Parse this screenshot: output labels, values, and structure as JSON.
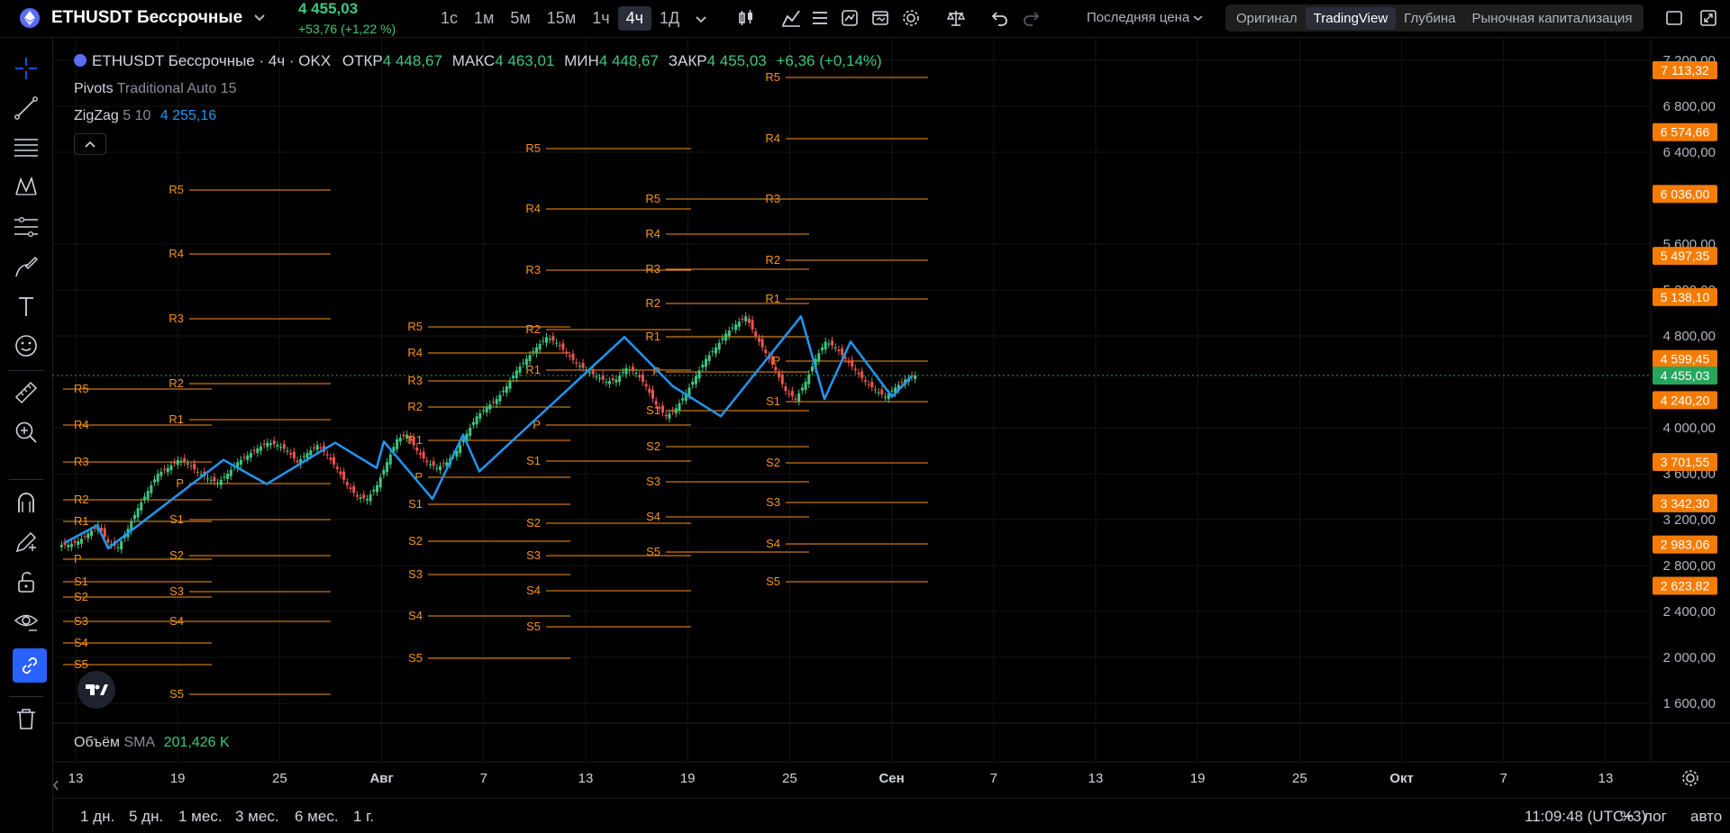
{
  "topbar": {
    "symbol": "ETHUSDT Бессрочные",
    "last_price": "4 455,03",
    "change": "+53,76 (+1,22 %)",
    "intervals": [
      "1с",
      "1м",
      "5м",
      "15м",
      "1ч",
      "4ч",
      "1Д"
    ],
    "active_interval": "4ч",
    "price_type": "Последняя цена",
    "view_tabs": [
      "Оригинал",
      "TradingView",
      "Глубина",
      "Рыночная капитализация"
    ],
    "active_view": "TradingView"
  },
  "legend": {
    "title": "ETHUSDT Бессрочные · 4ч · OKX",
    "open_label": "ОТКР",
    "open": "4 448,67",
    "high_label": "МАКС",
    "high": "4 463,01",
    "low_label": "МИН",
    "low": "4 448,67",
    "close_label": "ЗАКР",
    "close": "4 455,03",
    "change": "+6,36 (+0,14%)"
  },
  "indicators": {
    "pivots_name": "Pivots",
    "pivots_params": "Traditional Auto 15",
    "zigzag_name": "ZigZag",
    "zigzag_params": "5 10",
    "zigzag_value": "4 255,16"
  },
  "volume": {
    "label": "Объём",
    "sma": "SMA",
    "value": "201,426 K"
  },
  "bottom": {
    "ranges": [
      "1 дн.",
      "5 дн.",
      "1 мес.",
      "3 мес.",
      "6 мес.",
      "1 г."
    ],
    "clock": "11:09:48 (UTC+3)",
    "percent": "%",
    "log": "лог",
    "auto": "авто"
  },
  "colors": {
    "up": "#3dc77f",
    "down": "#ef5350",
    "pivot": "#f7931a",
    "zigzag": "#2196f3",
    "badge": "#f57c00",
    "last_badge": "#26a65b"
  },
  "chart_data": {
    "type": "candlestick",
    "price_axis": [
      "7 200,00",
      "6 800,00",
      "6 400,00",
      "5 600,00",
      "5 200,00",
      "4 800,00",
      "4 000,00",
      "3 600,00",
      "3 200,00",
      "2 800,00",
      "2 400,00",
      "2 000,00",
      "1 600,00"
    ],
    "price_badges": [
      "7 113,32",
      "6 574,66",
      "6 036,00",
      "5 497,35",
      "5 138,10",
      "4 599,45",
      "4 240,20",
      "3 701,55",
      "3 342,30",
      "2 983,06",
      "2 623,82"
    ],
    "last_price_badge": "4 455,03",
    "time_axis": [
      "13",
      "19",
      "25",
      "Авг",
      "7",
      "13",
      "19",
      "25",
      "Сен",
      "7",
      "13",
      "19",
      "25",
      "Окт",
      "7",
      "13"
    ],
    "pivot_labels": [
      "R5",
      "R4",
      "R3",
      "R2",
      "R1",
      "P",
      "S1",
      "S2",
      "S3",
      "S4",
      "S5"
    ],
    "zigzag": [
      3000,
      3150,
      2950,
      3720,
      3510,
      3870,
      3650,
      3880,
      3380,
      3940,
      3620,
      4790,
      4360,
      4100,
      4970,
      4250,
      4750,
      4270,
      4450
    ],
    "ohlc_close_series": [
      2980,
      3010,
      3080,
      3150,
      3000,
      2960,
      3120,
      3300,
      3450,
      3600,
      3650,
      3720,
      3690,
      3610,
      3560,
      3520,
      3600,
      3700,
      3760,
      3820,
      3870,
      3850,
      3800,
      3700,
      3780,
      3850,
      3760,
      3640,
      3500,
      3400,
      3380,
      3500,
      3700,
      3900,
      3940,
      3800,
      3700,
      3650,
      3700,
      3800,
      3950,
      4100,
      4180,
      4250,
      4360,
      4500,
      4600,
      4700,
      4790,
      4740,
      4650,
      4560,
      4500,
      4450,
      4400,
      4420,
      4520,
      4480,
      4360,
      4200,
      4100,
      4170,
      4300,
      4450,
      4600,
      4700,
      4820,
      4900,
      4970,
      4800,
      4650,
      4500,
      4320,
      4250,
      4400,
      4600,
      4750,
      4700,
      4600,
      4500,
      4400,
      4330,
      4270,
      4350,
      4420,
      4455
    ]
  }
}
